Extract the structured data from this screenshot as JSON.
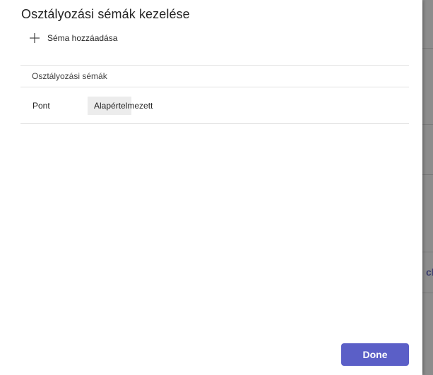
{
  "dialog": {
    "title": "Osztályozási sémák kezelése",
    "add_scheme_label": "Séma hozzáadása",
    "add_icon": "plus-icon",
    "done_label": "Done"
  },
  "table": {
    "header": "Osztályozási sémák",
    "rows": [
      {
        "name": "Pont",
        "badge": "Alapértelmezett"
      }
    ]
  },
  "background": {
    "partial_text": "ch"
  },
  "colors": {
    "accent": "#5b5fc7",
    "backdrop": "#8c8c8c"
  }
}
